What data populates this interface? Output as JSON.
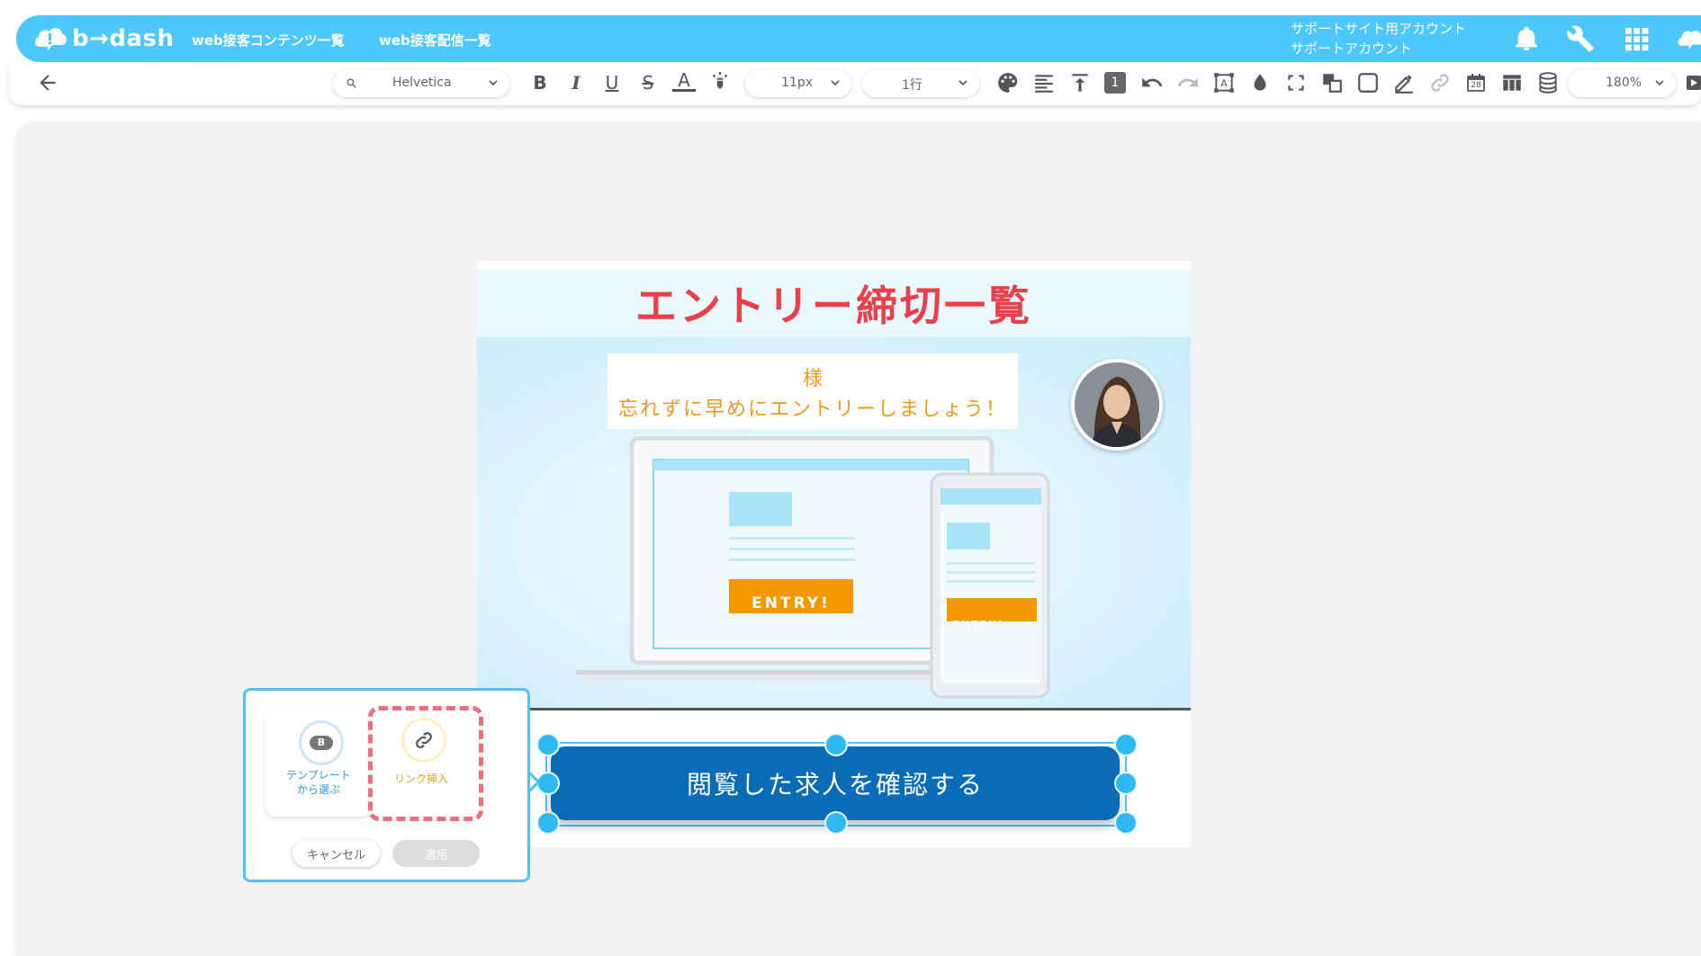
{
  "header": {
    "logo_text": "b→dash",
    "nav": [
      "web接客コンテンツ一覧",
      "web接客配信一覧"
    ],
    "account_line1": "サポートサイト用アカウント",
    "account_line2": "サポートアカウント",
    "icons": [
      "bell-icon",
      "wrench-icon",
      "apps-grid-icon",
      "user-cloud-icon"
    ]
  },
  "toolbar": {
    "font_family": "Helvetica",
    "font_size": "11px",
    "line_height": "1行",
    "layer_number": "1",
    "zoom": "180%",
    "calendar_day": "28"
  },
  "email": {
    "title": "エントリー締切一覧",
    "greeting": "様",
    "message": "忘れずに早めにエントリーしましょう！",
    "entry_label": "ENTRY!",
    "cta_label": "閲覧した求人を確認する"
  },
  "popover": {
    "template_label_1": "テンプレート",
    "template_label_2": "から選ぶ",
    "template_badge": "B",
    "link_label": "リンク挿入",
    "cancel_label": "キャンセル",
    "apply_label": "適用"
  },
  "colors": {
    "brand": "#4cc8ff",
    "title": "#e9404a",
    "message": "#f09a1d",
    "cta": "#0a6cb7",
    "entry": "#f39800",
    "link_highlight": "#f26e7c"
  }
}
